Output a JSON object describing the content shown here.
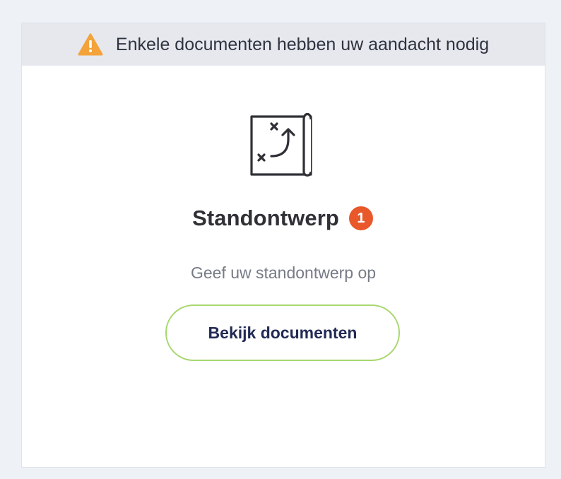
{
  "alert": {
    "message": "Enkele documenten hebben uw aandacht nodig",
    "icon": "warning-triangle-icon",
    "icon_color": "#f3a33a"
  },
  "item": {
    "icon": "plan-map-icon",
    "title": "Standontwerp",
    "badge_count": "1",
    "badge_color": "#e8582a",
    "description": "Geef uw standontwerp op"
  },
  "action": {
    "button_label": "Bekijk documenten",
    "border_color": "#a7d76f",
    "text_color": "#222a55"
  }
}
